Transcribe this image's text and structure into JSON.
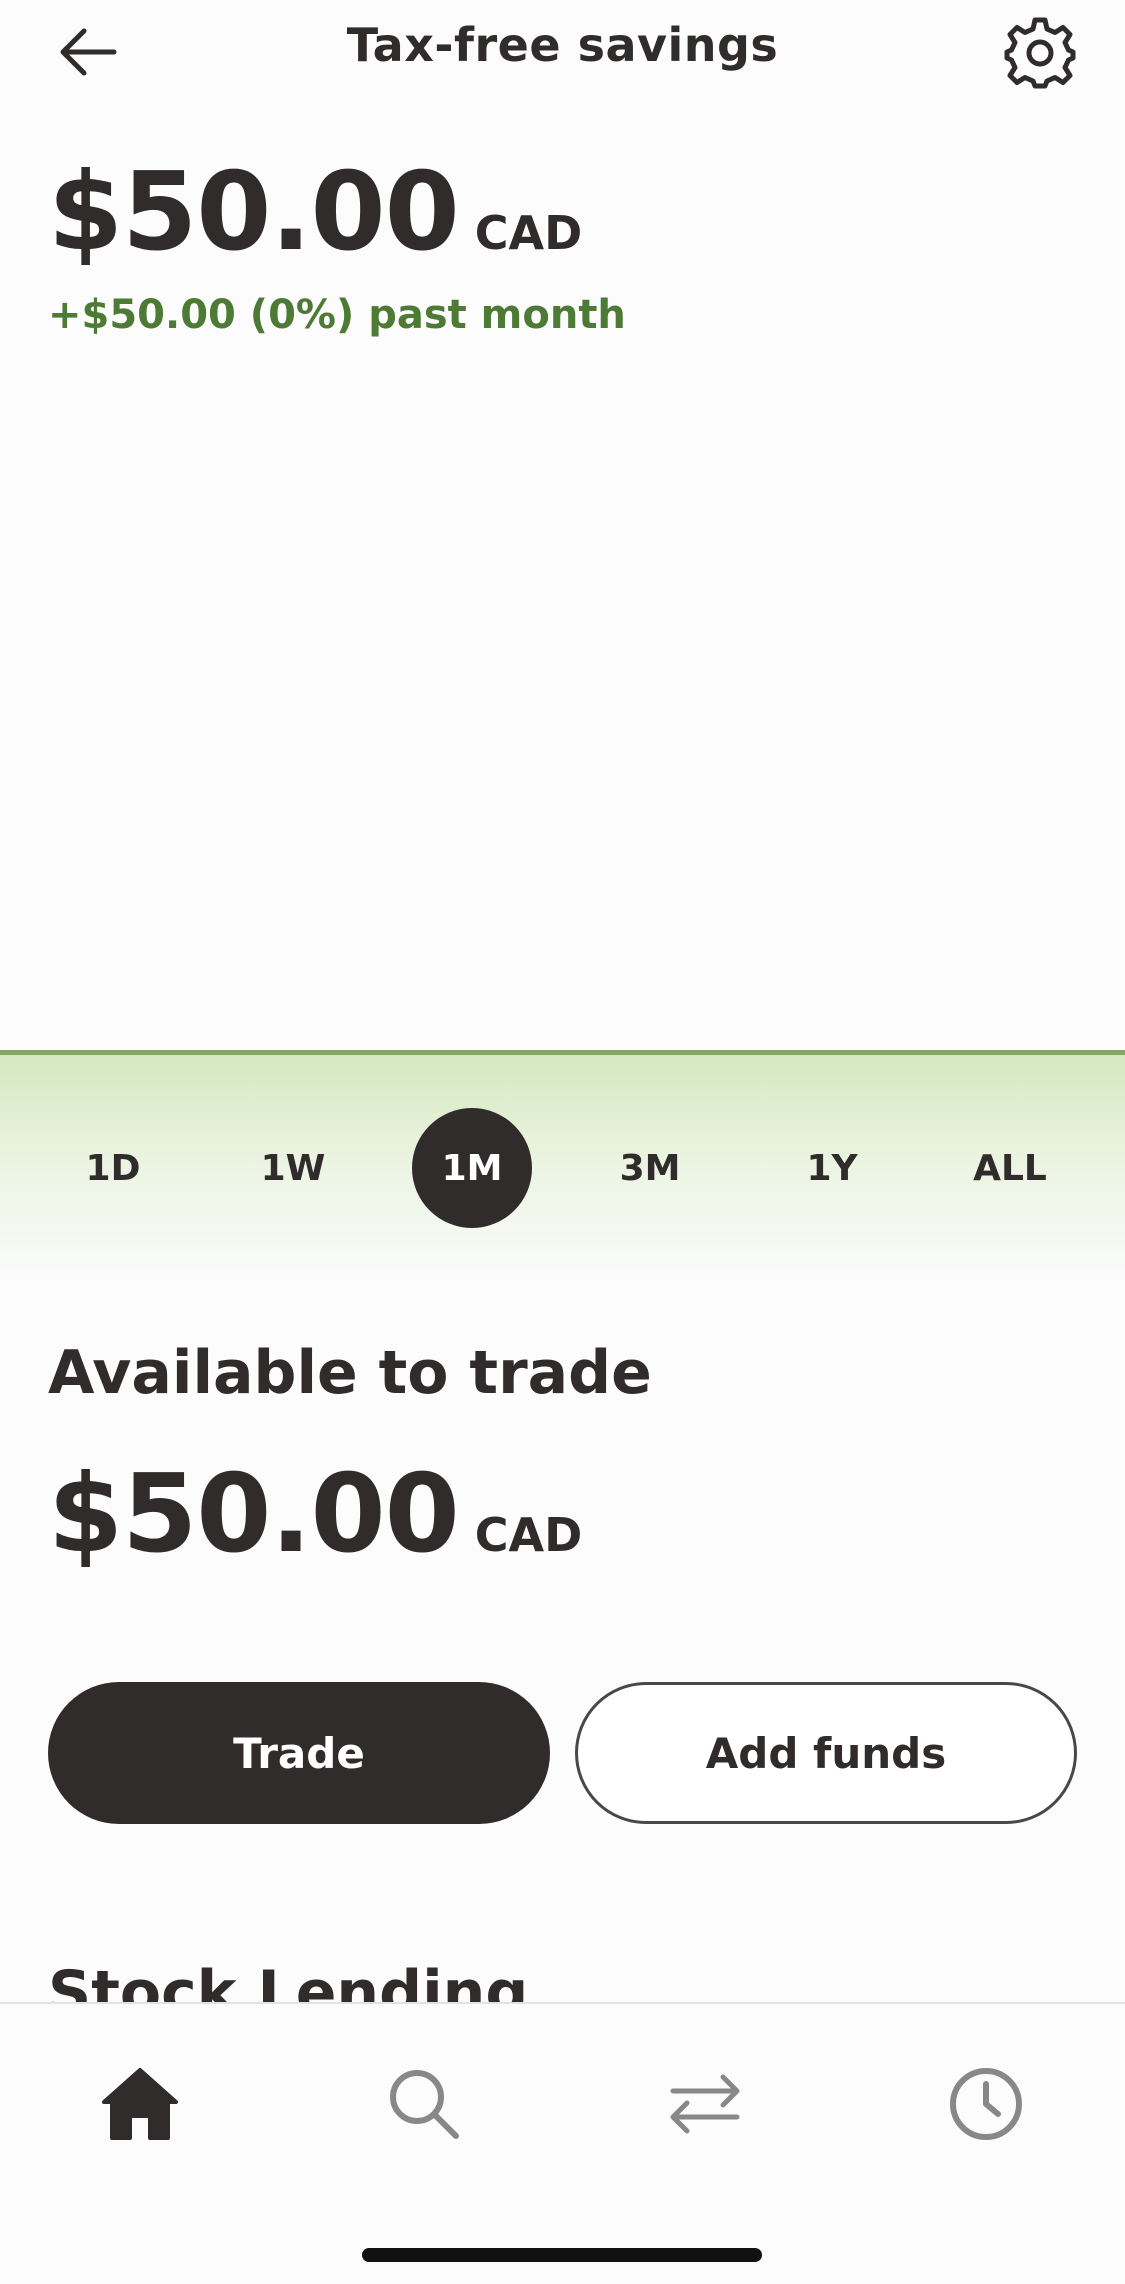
{
  "header": {
    "title": "Tax-free savings",
    "back_icon": "arrow-left-icon",
    "settings_icon": "gear-icon"
  },
  "balance": {
    "amount": "$50.00",
    "currency": "CAD",
    "change": "+$50.00 (0%) past month"
  },
  "range_selector": {
    "options": [
      "1D",
      "1W",
      "1M",
      "3M",
      "1Y",
      "ALL"
    ],
    "selected": "1M"
  },
  "available": {
    "title": "Available to trade",
    "amount": "$50.00",
    "currency": "CAD"
  },
  "actions": {
    "trade_label": "Trade",
    "add_funds_label": "Add funds"
  },
  "next_section": {
    "title": "Stock Lending"
  },
  "bottom_nav": {
    "items": [
      {
        "icon": "home-icon"
      },
      {
        "icon": "search-icon"
      },
      {
        "icon": "transfer-arrows-icon"
      },
      {
        "icon": "history-clock-icon"
      }
    ]
  },
  "colors": {
    "primary_dark": "#2f2c2b",
    "positive_green": "#4d7a35",
    "chart_line": "#86a863",
    "chart_fill": "#d4e8bf"
  }
}
